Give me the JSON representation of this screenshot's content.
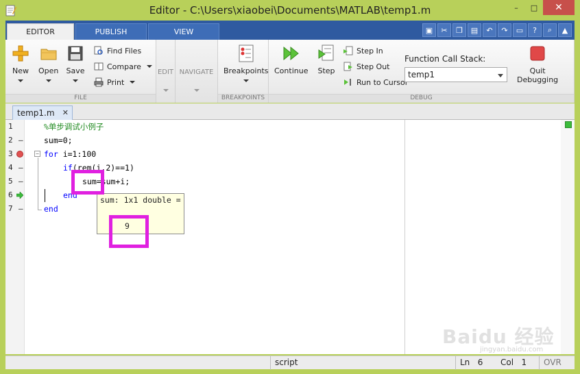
{
  "window": {
    "title": "Editor - C:\\Users\\xiaobei\\Documents\\MATLAB\\temp1.m",
    "minimize": "–",
    "maximize": "□",
    "close": "✕"
  },
  "ribbon_tabs": [
    {
      "label": "EDITOR",
      "active": true
    },
    {
      "label": "PUBLISH",
      "active": false
    },
    {
      "label": "VIEW",
      "active": false
    }
  ],
  "quick_access": [
    "save-icon",
    "cut-icon",
    "copy-icon",
    "paste-icon",
    "undo-icon",
    "redo-icon",
    "window-icon",
    "help-icon",
    "search-icon",
    "collapse-icon"
  ],
  "file_section": {
    "label": "FILE",
    "new": "New",
    "open": "Open",
    "save": "Save",
    "find_files": "Find Files",
    "compare": "Compare",
    "print": "Print"
  },
  "edit_section": {
    "label": "EDIT"
  },
  "navigate_section": {
    "label": "NAVIGATE"
  },
  "breakpoints_section": {
    "label": "BREAKPOINTS",
    "breakpoints": "Breakpoints"
  },
  "debug_section": {
    "label": "DEBUG",
    "continue": "Continue",
    "step": "Step",
    "step_in": "Step In",
    "step_out": "Step Out",
    "run_to_cursor": "Run to Cursor",
    "function_call_stack_label": "Function Call Stack:",
    "function_call_stack_value": "temp1",
    "quit_debugging_line1": "Quit",
    "quit_debugging_line2": "Debugging"
  },
  "document_tab": {
    "label": "temp1.m",
    "close": "✕"
  },
  "code_lines": [
    {
      "num": "1",
      "dash": "",
      "text": "%单步调试小例子"
    },
    {
      "num": "2",
      "dash": "–",
      "text": "sum=0;"
    },
    {
      "num": "3",
      "dash": "",
      "text": "for i=1:100"
    },
    {
      "num": "4",
      "dash": "–",
      "text": "if(rem(i,2)==1)"
    },
    {
      "num": "5",
      "dash": "–",
      "text": "sum=sum+i;"
    },
    {
      "num": "6",
      "dash": "–",
      "text": "end"
    },
    {
      "num": "7",
      "dash": "–",
      "text": "end"
    }
  ],
  "keywords": {
    "for": "for",
    "if": "if",
    "end": "end"
  },
  "datatip": {
    "header": "sum: 1x1 double =",
    "value": "9"
  },
  "status_bar": {
    "mode": "script",
    "ln_label": "Ln",
    "ln_value": "6",
    "col_label": "Col",
    "col_value": "1",
    "ovr": "OVR"
  },
  "colors": {
    "frame": "#b8d05a",
    "tab_strip": "#2f5aa0",
    "keyword": "#0000ff",
    "comment": "#228b22",
    "breakpoint": "#e05252",
    "highlight": "#e020e0",
    "datatip_bg": "#ffffe1"
  },
  "watermark": {
    "text": "Baidu 经验",
    "url": "jingyan.baidu.com"
  }
}
